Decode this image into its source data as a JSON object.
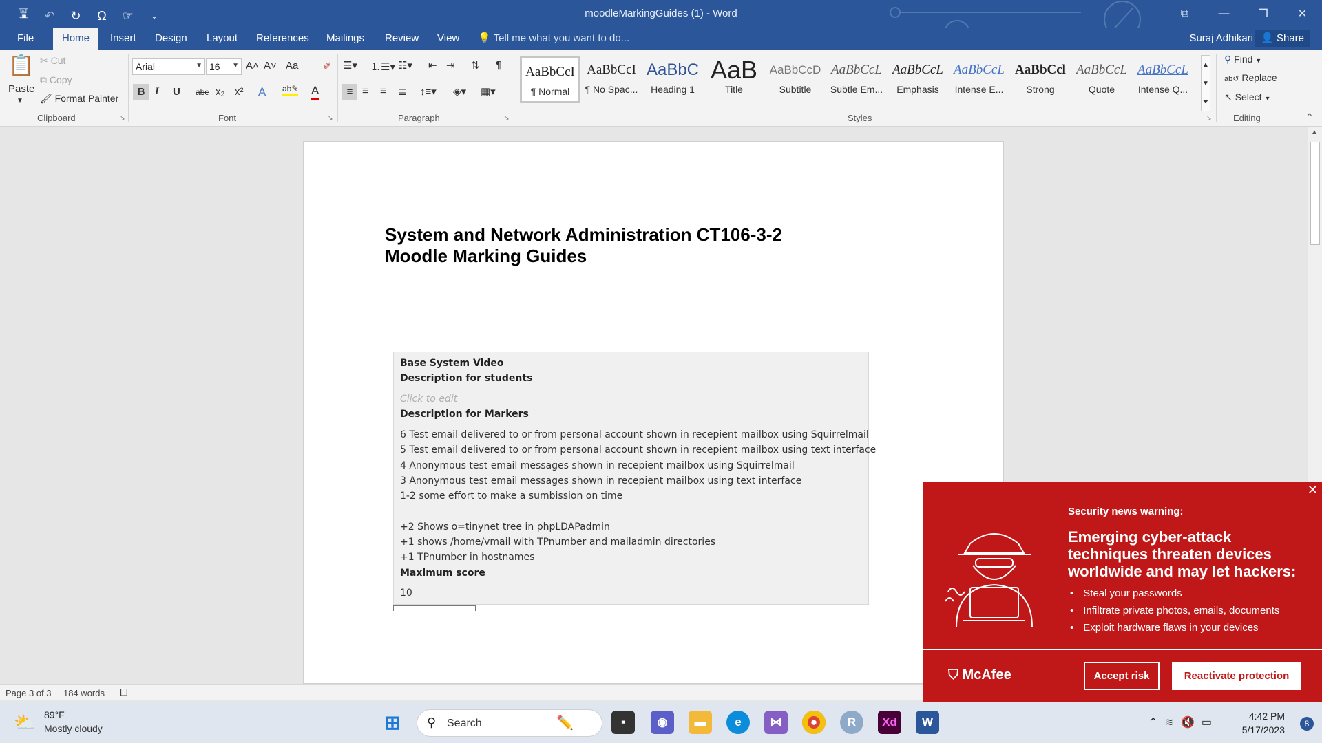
{
  "titlebar": {
    "title": "moodleMarkingGuides (1) - Word",
    "qat": [
      "save-icon",
      "undo-icon",
      "redo-icon",
      "symbol-icon",
      "touch-mode-icon",
      "customize-icon"
    ]
  },
  "tabs": {
    "file": "File",
    "home": "Home",
    "insert": "Insert",
    "design": "Design",
    "layout": "Layout",
    "references": "References",
    "mailings": "Mailings",
    "review": "Review",
    "view": "View",
    "tell_me": "Tell me what you want to do...",
    "user": "Suraj Adhikari",
    "share": "Share"
  },
  "ribbon": {
    "clipboard": {
      "label": "Clipboard",
      "paste": "Paste",
      "cut": "Cut",
      "copy": "Copy",
      "format_painter": "Format Painter"
    },
    "font": {
      "label": "Font",
      "font_name": "Arial",
      "font_size": "16",
      "bold": "B",
      "italic": "I",
      "underline": "U",
      "strike": "abc",
      "subscript": "x₂",
      "superscript": "x²",
      "change_case": "Aa",
      "grow": "A˄",
      "shrink": "A˅"
    },
    "paragraph": {
      "label": "Paragraph"
    },
    "styles": {
      "label": "Styles",
      "items": [
        {
          "sample": "AaBbCcI",
          "name": "¶ Normal"
        },
        {
          "sample": "AaBbCcI",
          "name": "¶ No Spac..."
        },
        {
          "sample": "AaBbC",
          "name": "Heading 1"
        },
        {
          "sample": "AaB",
          "name": "Title"
        },
        {
          "sample": "AaBbCcD",
          "name": "Subtitle"
        },
        {
          "sample": "AaBbCcL",
          "name": "Subtle Em..."
        },
        {
          "sample": "AaBbCcL",
          "name": "Emphasis"
        },
        {
          "sample": "AaBbCcL",
          "name": "Intense E..."
        },
        {
          "sample": "AaBbCcl",
          "name": "Strong"
        },
        {
          "sample": "AaBbCcL",
          "name": "Quote"
        },
        {
          "sample": "AaBbCcL",
          "name": "Intense Q..."
        }
      ]
    },
    "editing": {
      "label": "Editing",
      "find": "Find",
      "replace": "Replace",
      "select": "Select"
    }
  },
  "document": {
    "heading_line1": "System and Network Administration CT106-3-2",
    "heading_line2": "Moodle Marking Guides",
    "guide": {
      "title": "Base System Video",
      "students_label": "Description for students",
      "placeholder": "Click to edit",
      "markers_label": "Description for Markers",
      "lines": [
        "6 Test email delivered to or from personal account shown in recepient mailbox using Squirrelmail",
        "5 Test email delivered to or from personal account shown in recepient mailbox using text interface",
        "4 Anonymous test email messages shown in recepient mailbox using Squirrelmail",
        "3 Anonymous test email messages shown in recepient mailbox using text interface",
        "1-2 some effort to make a sumbission on time",
        "+2 Shows o=tinynet tree in phpLDAPadmin",
        "+1 shows /home/vmail with TPnumber and mailadmin directories",
        "+1 TPnumber in hostnames"
      ],
      "max_label": "Maximum score",
      "max_value": "10"
    }
  },
  "statusbar": {
    "page": "Page 3 of 3",
    "words": "184 words"
  },
  "mcafee": {
    "warn_label": "Security news warning:",
    "headline": "Emerging cyber-attack techniques threaten devices worldwide and may let hackers:",
    "bullets": [
      "Steal your passwords",
      "Infiltrate private photos, emails, documents",
      "Exploit hardware flaws in your devices"
    ],
    "logo": "McAfee",
    "accept": "Accept risk",
    "reactivate": "Reactivate protection",
    "brand_color": "#c01818"
  },
  "taskbar": {
    "temp": "89°F",
    "weather": "Mostly cloudy",
    "search": "Search",
    "time": "4:42 PM",
    "date": "5/17/2023",
    "notifications": "8",
    "apps": [
      "start-icon",
      "search-icon",
      "terminal-icon",
      "chat-icon",
      "file-explorer-icon",
      "edge-icon",
      "visual-studio-icon",
      "chrome-icon",
      "r-icon",
      "adobe-xd-icon",
      "word-icon"
    ]
  },
  "colors": {
    "word_blue": "#2b579a"
  }
}
